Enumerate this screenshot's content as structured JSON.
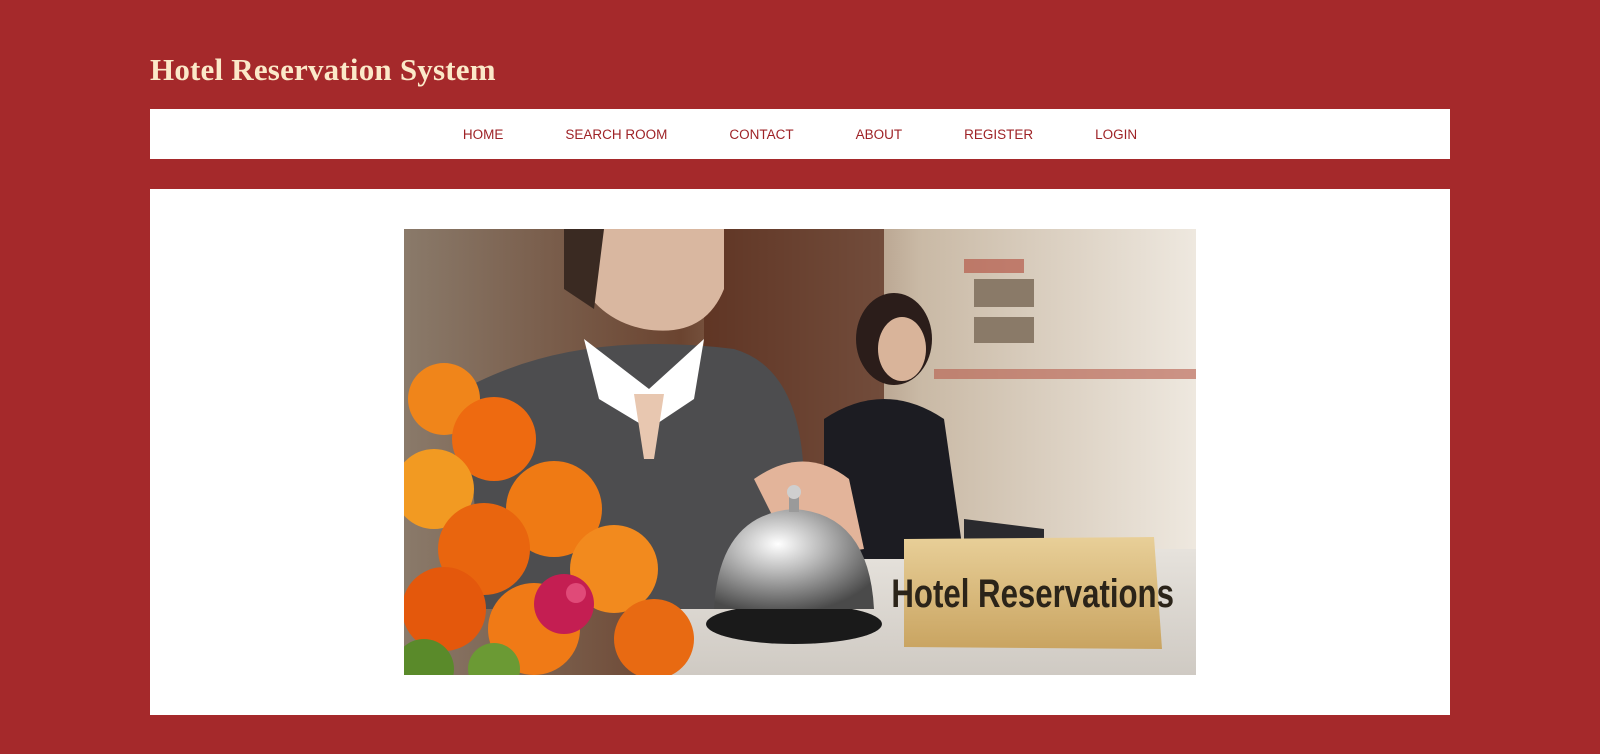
{
  "header": {
    "title": "Hotel Reservation System"
  },
  "nav": {
    "items": [
      {
        "label": "HOME"
      },
      {
        "label": "SEARCH ROOM"
      },
      {
        "label": "CONTACT"
      },
      {
        "label": "ABOUT"
      },
      {
        "label": "REGISTER"
      },
      {
        "label": "LOGIN"
      }
    ]
  },
  "hero": {
    "sign_text": "Hotel Reservations"
  },
  "colors": {
    "background": "#a5292b",
    "title_text": "#fbe9c9",
    "nav_text": "#9e2226",
    "panel": "#ffffff"
  }
}
